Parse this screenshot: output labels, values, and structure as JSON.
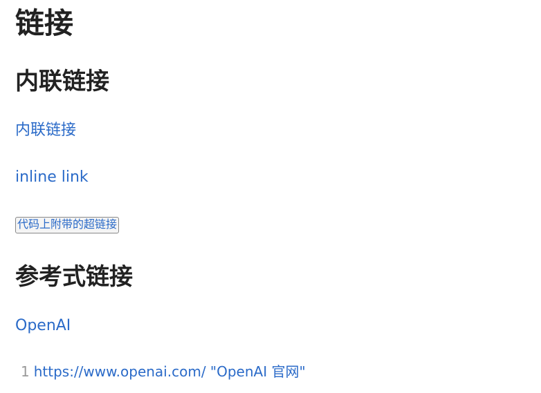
{
  "title": "链接",
  "sections": [
    {
      "heading": "内联链接",
      "links": [
        {
          "text": "内联链接"
        },
        {
          "text": "inline link"
        }
      ],
      "code_link": "代码上附带的超链接"
    },
    {
      "heading": "参考式链接",
      "links": [
        {
          "text": "OpenAI"
        }
      ]
    }
  ],
  "footnote": {
    "number": "1",
    "text": "https://www.openai.com/ \"OpenAI 官网\""
  },
  "colors": {
    "link": "#2a6ac8",
    "heading": "#222222",
    "footnote_number": "#999999"
  }
}
